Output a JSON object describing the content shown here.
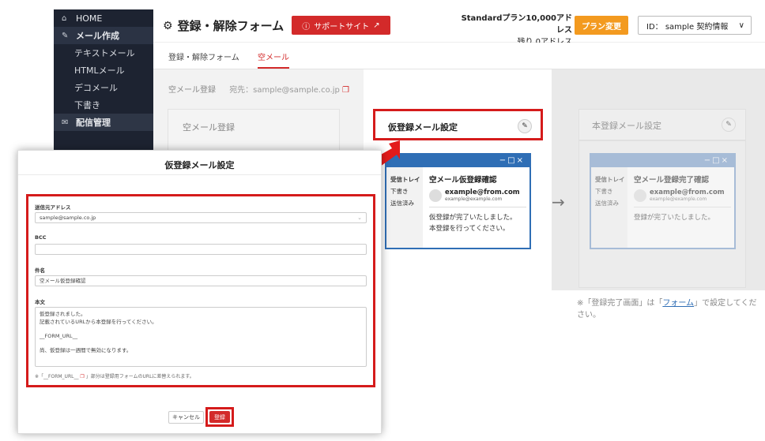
{
  "sidebar": {
    "items": [
      {
        "label": "HOME",
        "icon": "home-icon"
      },
      {
        "label": "メール作成",
        "icon": "pencil-icon"
      },
      {
        "label": "テキストメール"
      },
      {
        "label": "HTMLメール"
      },
      {
        "label": "デコメール"
      },
      {
        "label": "下書き"
      },
      {
        "label": "配信管理",
        "icon": "mail-icon"
      }
    ]
  },
  "header": {
    "title": "登録・解除フォーム",
    "support_label": "サポートサイト",
    "plan_line1": "Standardプラン10,000アドレス",
    "plan_line2": "残り 0アドレス",
    "plan_change_label": "プラン変更",
    "account_label": "ID： sample  契約情報"
  },
  "tabs": [
    {
      "label": "登録・解除フォーム"
    },
    {
      "label": "空メール",
      "active": true
    }
  ],
  "main": {
    "section_label": "空メール登録",
    "address_label": "宛先：sample@sample.co.jp",
    "ghost_card_title": "空メール登録",
    "kari_title": "仮登録メール設定",
    "hon_title": "本登録メール設定",
    "note_prefix": "※「登録完了画面」は「",
    "note_link": "フォーム",
    "note_suffix": "」で設定してください。"
  },
  "email_kari": {
    "window_controls": "−□×",
    "inbox": "受信トレイ",
    "drafts": "下書き",
    "sent": "送信済み",
    "subject": "空メール仮登録確認",
    "from_addr": "example@from.com",
    "from_sub": "example@example.com",
    "body_line1": "仮登録が完了いたしました。",
    "body_line2": "本登録を行ってください。"
  },
  "email_hon": {
    "window_controls": "−□×",
    "inbox": "受信トレイ",
    "drafts": "下書き",
    "sent": "送信済み",
    "subject": "空メール登録完了確認",
    "from_addr": "example@from.com",
    "from_sub": "example@example.com",
    "body_line1": "登録が完了いたしました。"
  },
  "modal": {
    "title": "仮登録メール設定",
    "sender_label": "送信元アドレス",
    "sender_value": "sample@sample.co.jp",
    "bcc_label": "BCC",
    "bcc_value": "",
    "subject_label": "件名",
    "subject_value": "空メール仮登録確認",
    "body_label": "本文",
    "body_line1": "仮登録されました。",
    "body_line2": "記載されているURLから本登録を行ってください。",
    "body_line3": "__FORM_URL__",
    "body_line4": "尚、仮登録は一週間で無効になります。",
    "note_prefix": "※「__FORM_URL__",
    "note_suffix": "」部分は登録用フォームのURLに差替えられます。",
    "cancel_label": "キャンセル",
    "submit_label": "登録"
  },
  "colors": {
    "accent_red": "#d32a2a",
    "orange": "#f39a1f",
    "sidebar_bg": "#1d2331",
    "email_blue": "#2f6eb5"
  }
}
